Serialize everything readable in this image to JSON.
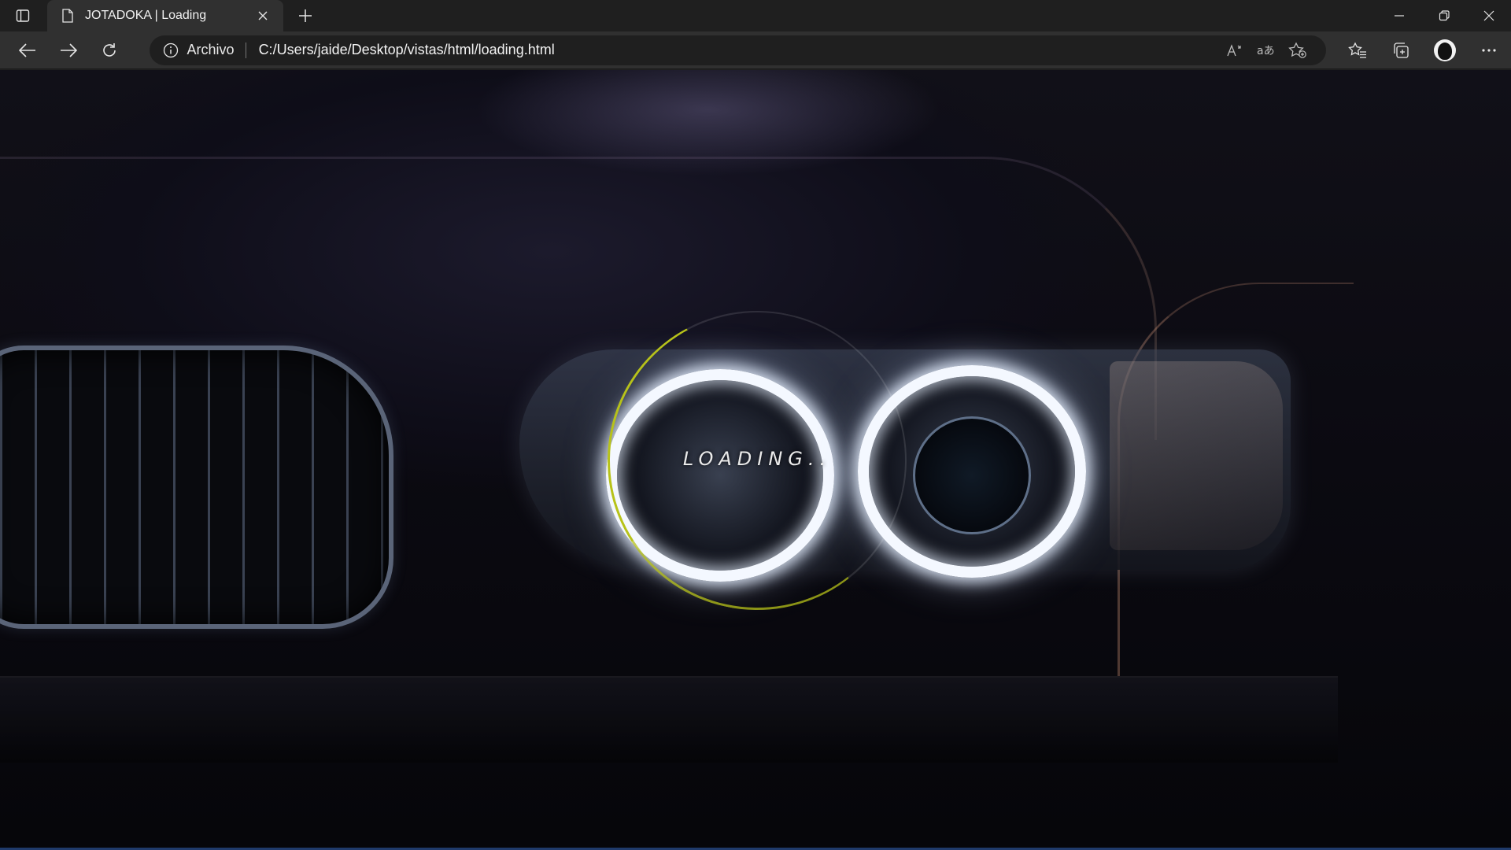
{
  "browser": {
    "tab": {
      "title": "JOTADOKA | Loading",
      "icon": "page-icon"
    },
    "address_bar": {
      "scheme_label": "Archivo",
      "url": "C:/Users/jaide/Desktop/vistas/html/loading.html"
    },
    "icons": {
      "tab_actions": "tab-actions-icon",
      "close_tab": "close-icon",
      "new_tab": "plus-icon",
      "back": "back-arrow-icon",
      "forward": "forward-arrow-icon",
      "refresh": "refresh-icon",
      "site_info": "info-icon",
      "read_aloud": "read-aloud-icon",
      "translate": "translate-icon",
      "add_favorite": "star-add-icon",
      "favorites": "favorites-icon",
      "collections": "collections-icon",
      "profile": "avatar",
      "menu": "more-icon",
      "minimize": "minimize-icon",
      "restore": "restore-icon",
      "close_window": "close-window-icon"
    }
  },
  "page": {
    "loading_text": "LOADING..",
    "accent_color": "#b7c21a"
  }
}
